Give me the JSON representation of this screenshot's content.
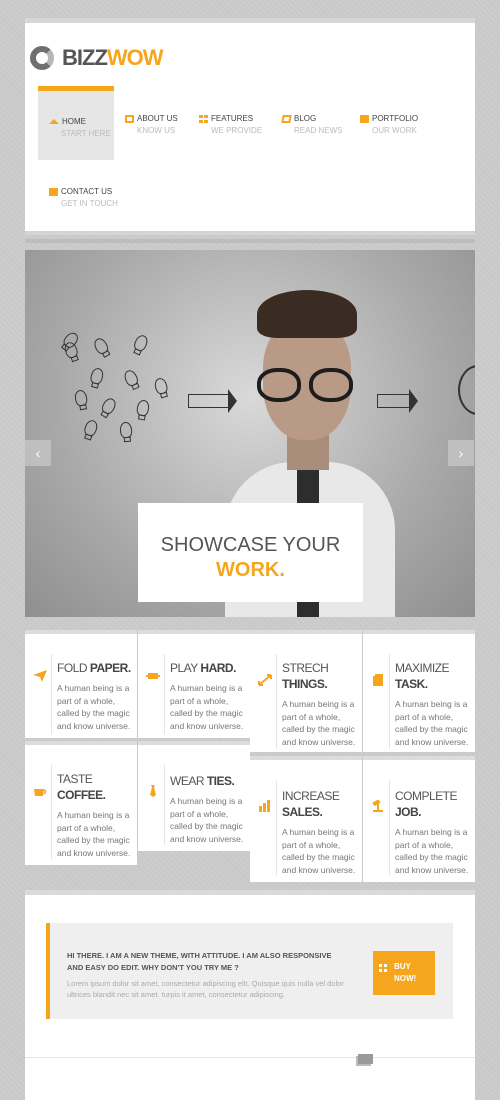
{
  "logo": {
    "part1": "BIZZ",
    "part2": "WOW"
  },
  "nav": [
    {
      "label": "HOME",
      "sub": "START HERE",
      "icon": "home-icon",
      "active": true
    },
    {
      "label": "ABOUT US",
      "sub": "KNOW US",
      "icon": "about-icon"
    },
    {
      "label": "FEATURES",
      "sub": "WE PROVIDE",
      "icon": "features-icon"
    },
    {
      "label": "BLOG",
      "sub": "READ NEWS",
      "icon": "blog-icon"
    },
    {
      "label": "PORTFOLIO",
      "sub": "OUR WORK",
      "icon": "portfolio-icon"
    },
    {
      "label": "CONTACT US",
      "sub": "GET IN TOUCH",
      "icon": "mail-icon"
    }
  ],
  "slider": {
    "line1": "SHOWCASE YOUR",
    "line2": "WORK.",
    "prev": "‹",
    "next": "›"
  },
  "features": [
    {
      "light": "FOLD",
      "bold": "PAPER.",
      "icon": "paper-plane-icon",
      "text": "A human being is a part of a whole, called by the magic and know universe."
    },
    {
      "light": "PLAY",
      "bold": "HARD.",
      "icon": "game-icon",
      "text": "A human being is a part of a whole, called by the magic and know universe."
    },
    {
      "light": "STRECH",
      "bold": "THINGS.",
      "icon": "resize-icon",
      "text": "A human being is a part of a whole, called by the magic and know universe."
    },
    {
      "light": "MAXIMIZE",
      "bold": "TASK.",
      "icon": "layers-icon",
      "text": "A human being is a part of a whole, called by the magic and know universe."
    },
    {
      "light": "TASTE",
      "bold": "COFFEE.",
      "icon": "coffee-icon",
      "text": "A human being is a part of a whole, called by the magic and know universe."
    },
    {
      "light": "WEAR",
      "bold": "TIES.",
      "icon": "tie-icon",
      "text": "A human being is a part of a whole, called by the magic and know universe."
    },
    {
      "light": "INCREASE",
      "bold": "SALES.",
      "icon": "chart-icon",
      "text": "A human being is a part of a whole, called by the magic and know universe."
    },
    {
      "light": "COMPLETE",
      "bold": "JOB.",
      "icon": "gavel-icon",
      "text": "A human being is a part of a whole, called by the magic and know universe."
    }
  ],
  "cta": {
    "title": "HI THERE. I AM A NEW THEME, WITH ATTITUDE. I AM ALSO RESPONSIVE AND EASY DO EDIT. WHY DON'T YOU TRY ME ?",
    "text": "Lorem ipsum dolor sit amet, consectetur adipiscing elit. Quisque quis nulla vel dolor ultrices blandit nec sit amet. turpis it amet, consectetur adipiscing.",
    "button": "BUY NOW!"
  },
  "colors": {
    "accent": "#f6a61c",
    "text": "#555555"
  }
}
